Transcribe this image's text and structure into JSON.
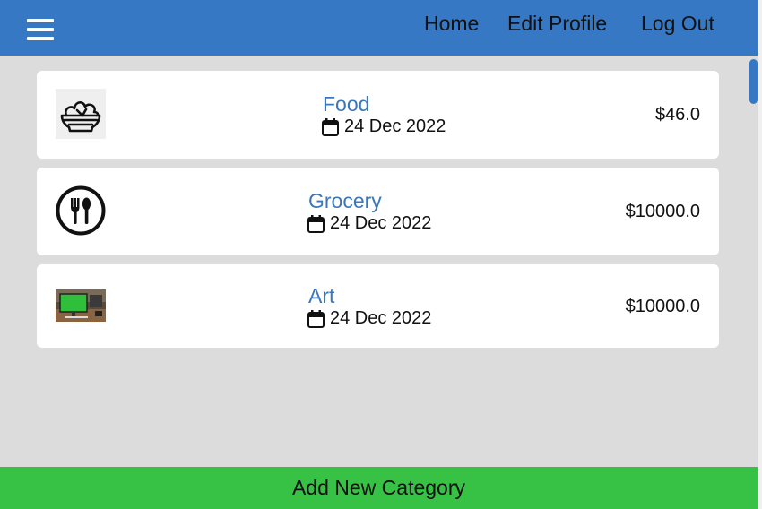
{
  "nav": {
    "menu_icon": "hamburger-menu-icon",
    "links": [
      "Home",
      "Edit Profile",
      "Log Out"
    ]
  },
  "categories": [
    {
      "name": "Food",
      "date": "24 Dec 2022",
      "amount": "$46.0",
      "icon": "salad-bowl-icon"
    },
    {
      "name": "Grocery",
      "date": "24 Dec 2022",
      "amount": "$10000.0",
      "icon": "fork-spoon-icon"
    },
    {
      "name": "Art",
      "date": "24 Dec 2022",
      "amount": "$10000.0",
      "icon": "computer-desk-image"
    }
  ],
  "date_icon": "calendar-icon",
  "add_button": "Add New Category",
  "colors": {
    "navbar": "#3678c4",
    "background": "#dcdcdc",
    "category_name": "#3b77bd",
    "add_button": "#37c246"
  }
}
